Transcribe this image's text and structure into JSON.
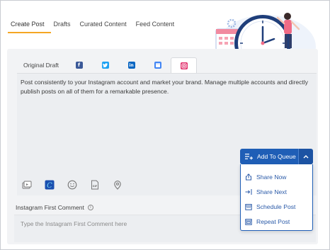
{
  "top_tabs": [
    {
      "label": "Create Post",
      "active": true
    },
    {
      "label": "Drafts",
      "active": false
    },
    {
      "label": "Curated Content",
      "active": false
    },
    {
      "label": "Feed Content",
      "active": false
    }
  ],
  "draft_tabs": {
    "original_label": "Original Draft",
    "networks": [
      {
        "name": "facebook-icon",
        "glyph": "f",
        "color": "#3b5998"
      },
      {
        "name": "twitter-icon",
        "glyph": "t",
        "color": "#1da1f2"
      },
      {
        "name": "linkedin-icon",
        "glyph": "in",
        "color": "#0a66c2"
      },
      {
        "name": "google-business-icon",
        "glyph": "g",
        "color": "#4285f4"
      },
      {
        "name": "instagram-icon",
        "glyph": "ig",
        "color": "#e1306c",
        "active": true
      }
    ]
  },
  "editor": {
    "text": "Post consistently to your Instagram account and market your brand. Manage multiple accounts and directly publish posts on all of them for a remarkable presence."
  },
  "toolbar": {
    "icons": [
      "media-library-icon",
      "canva-icon",
      "emoji-icon",
      "gif-icon",
      "location-pin-icon"
    ],
    "gif_text": "GIF"
  },
  "comment": {
    "label": "Instagram First Comment",
    "info_glyph": "i",
    "placeholder": "Type the Instagram First Comment here"
  },
  "queue": {
    "button_label": "Add To Queue",
    "accent": "#1f5eb6",
    "menu": [
      {
        "label": "Share Now",
        "icon": "share-icon"
      },
      {
        "label": "Share Next",
        "icon": "share-next-icon"
      },
      {
        "label": "Schedule Post",
        "icon": "calendar-icon"
      },
      {
        "label": "Repeat Post",
        "icon": "repeat-icon"
      }
    ]
  }
}
